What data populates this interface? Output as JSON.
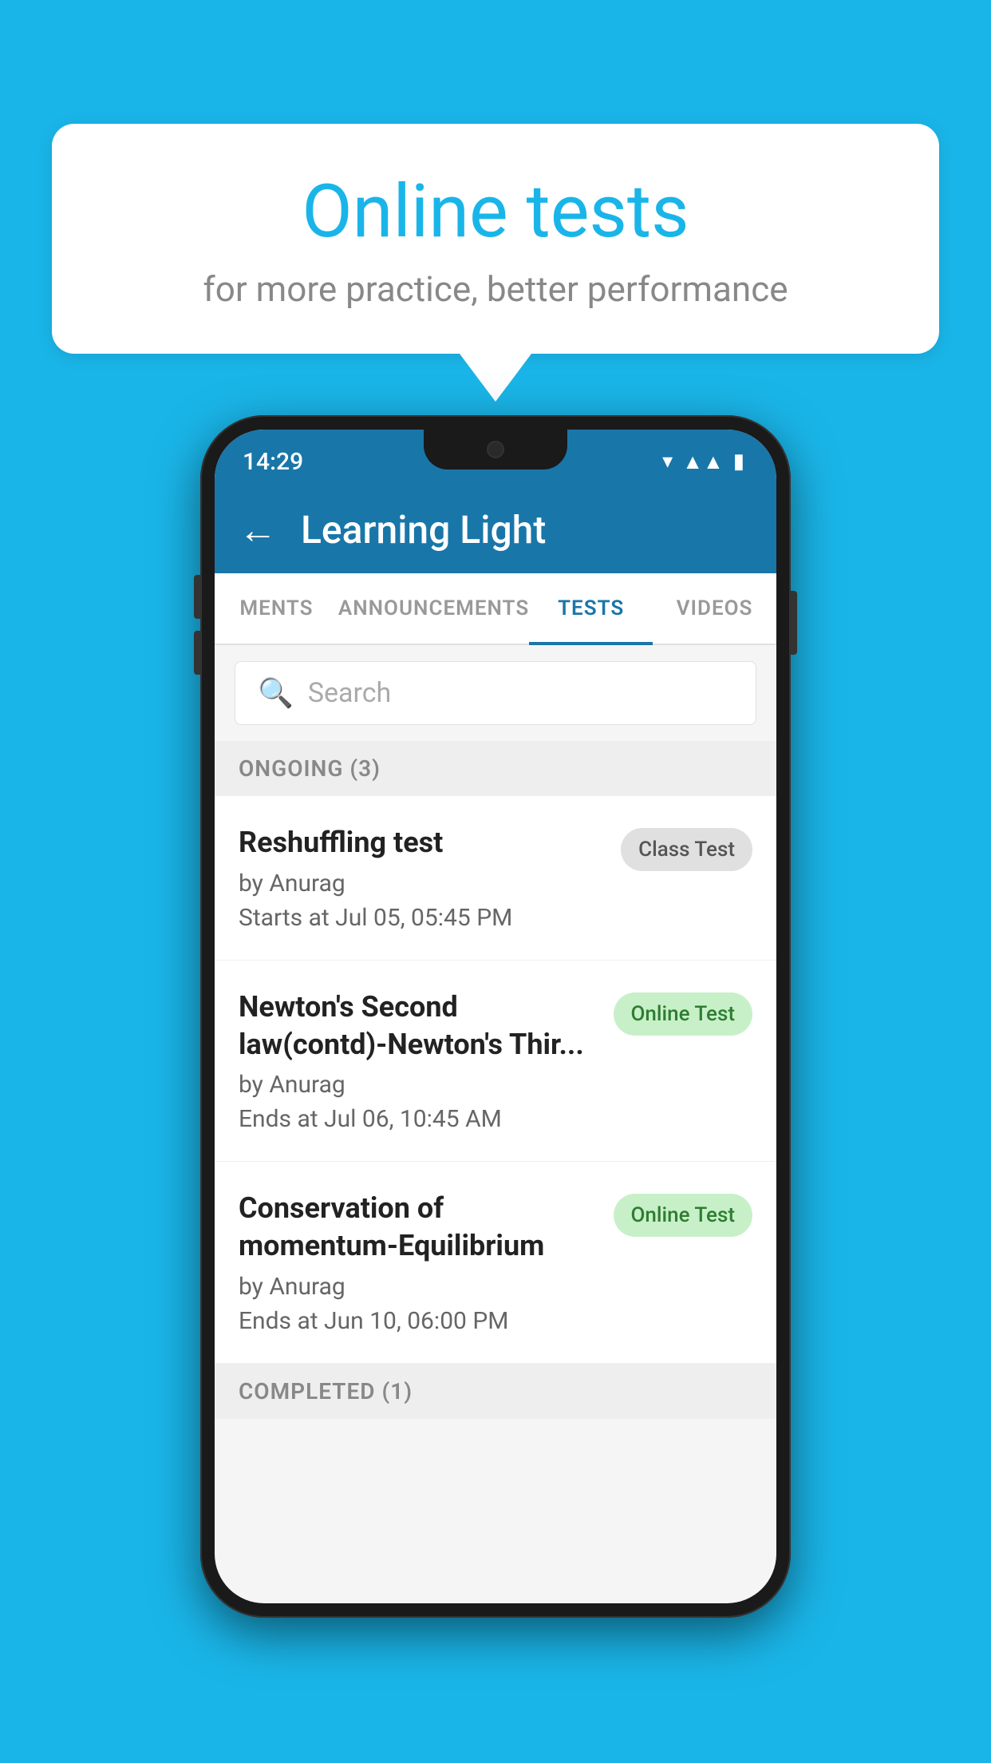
{
  "background_color": "#1ab5e8",
  "speech_bubble": {
    "title": "Online tests",
    "subtitle": "for more practice, better performance"
  },
  "phone": {
    "status_bar": {
      "time": "14:29",
      "icons": [
        "wifi",
        "signal",
        "battery"
      ]
    },
    "app_bar": {
      "title": "Learning Light",
      "back_label": "←"
    },
    "tabs": [
      {
        "label": "MENTS",
        "active": false
      },
      {
        "label": "ANNOUNCEMENTS",
        "active": false
      },
      {
        "label": "TESTS",
        "active": true
      },
      {
        "label": "VIDEOS",
        "active": false
      }
    ],
    "search": {
      "placeholder": "Search"
    },
    "ongoing_section": {
      "header": "ONGOING (3)",
      "items": [
        {
          "title": "Reshuffling test",
          "author": "by Anurag",
          "date": "Starts at  Jul 05, 05:45 PM",
          "badge": "Class Test",
          "badge_type": "gray"
        },
        {
          "title": "Newton's Second law(contd)-Newton's Thir...",
          "author": "by Anurag",
          "date": "Ends at  Jul 06, 10:45 AM",
          "badge": "Online Test",
          "badge_type": "green"
        },
        {
          "title": "Conservation of momentum-Equilibrium",
          "author": "by Anurag",
          "date": "Ends at  Jun 10, 06:00 PM",
          "badge": "Online Test",
          "badge_type": "green"
        }
      ]
    },
    "completed_section": {
      "header": "COMPLETED (1)"
    }
  }
}
